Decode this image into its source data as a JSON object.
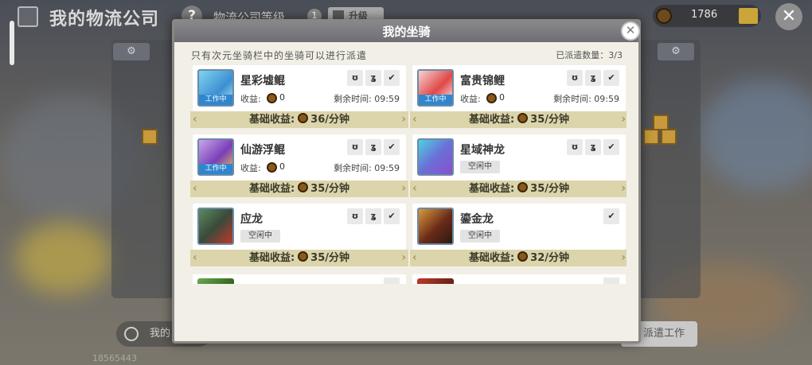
{
  "hud": {
    "title": "我的物流公司",
    "help": "?",
    "level_label": "物流公司等级",
    "level": "1",
    "upgrade_label": "升级",
    "coins": "1786",
    "close_glyph": "✕"
  },
  "bottom": {
    "my_label": "我的",
    "player_id": "18565443",
    "dispatch_label": "派遣工作"
  },
  "modal": {
    "title": "我的坐骑",
    "close_glyph": "✕",
    "notice": "只有次元坐骑栏中的坐骑可以进行派遣",
    "dispatched": "已派遣数量：3/3",
    "earn_label": "收益:",
    "remain_label": "剩余时间:",
    "base_label": "基础收益:",
    "working_tag": "工作中",
    "idle_tag": "空闲中",
    "mounts": [
      {
        "name": "星彩墟鲲",
        "status": "working",
        "earn": "0",
        "remain": "09:59",
        "base": "36/分钟",
        "traits": [
          "ʊ",
          "ʓ",
          "✔"
        ]
      },
      {
        "name": "富贵锦鲤",
        "status": "working",
        "earn": "0",
        "remain": "09:59",
        "base": "35/分钟",
        "traits": [
          "ʊ",
          "ʓ",
          "✔"
        ]
      },
      {
        "name": "仙游浮鲲",
        "status": "working",
        "earn": "0",
        "remain": "09:59",
        "base": "35/分钟",
        "traits": [
          "ʊ",
          "ʓ",
          "✔"
        ]
      },
      {
        "name": "星域神龙",
        "status": "idle",
        "base": "35/分钟",
        "traits": [
          "ʊ",
          "ʓ",
          "✔"
        ]
      },
      {
        "name": "应龙",
        "status": "idle",
        "base": "35/分钟",
        "traits": [
          "ʊ",
          "ʓ",
          "✔"
        ]
      },
      {
        "name": "鎏金龙",
        "status": "idle",
        "base": "32/分钟",
        "traits": [
          "✔"
        ]
      }
    ]
  },
  "colors": {
    "accent_blue": "#2f86cf",
    "strip": "#dcd4ab",
    "header": "#7a797e"
  }
}
